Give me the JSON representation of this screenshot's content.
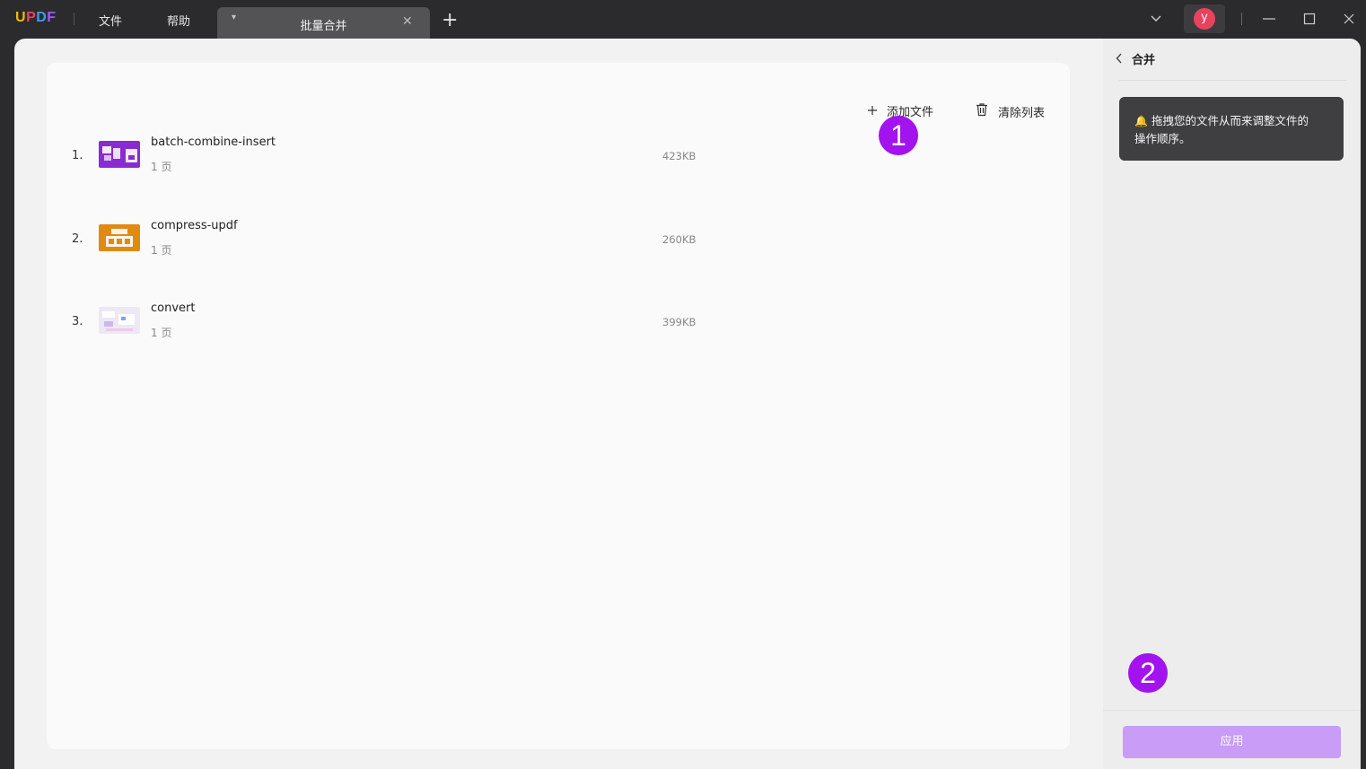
{
  "app": {
    "logo": [
      "U",
      "P",
      "D",
      "F"
    ],
    "logo_colors": [
      "#f5b800",
      "#e8425f",
      "#3a9cf5",
      "#9b5cf6"
    ]
  },
  "menu": {
    "file": "文件",
    "help": "帮助"
  },
  "tab": {
    "title": "批量合并"
  },
  "user": {
    "avatar_letter": "y"
  },
  "toolbar": {
    "add_files": "添加文件",
    "clear_list": "清除列表"
  },
  "files": [
    {
      "num": "1.",
      "name": "batch-combine-insert",
      "pages": "1 页",
      "size": "423KB",
      "thumb_color": "#8a2bd2"
    },
    {
      "num": "2.",
      "name": "compress-updf",
      "pages": "1 页",
      "size": "260KB",
      "thumb_color": "#e08a12"
    },
    {
      "num": "3.",
      "name": "convert",
      "pages": "1 页",
      "size": "399KB",
      "thumb_color": "#e9e7f3"
    }
  ],
  "badges": {
    "one": "1",
    "two": "2"
  },
  "panel": {
    "title": "合并",
    "tip_line1": "拖拽您的文件从而来调整文件的",
    "tip_line2": "操作顺序。",
    "apply": "应用"
  },
  "colors": {
    "badge": "#a313ee",
    "apply_button": "#c89cf7"
  }
}
